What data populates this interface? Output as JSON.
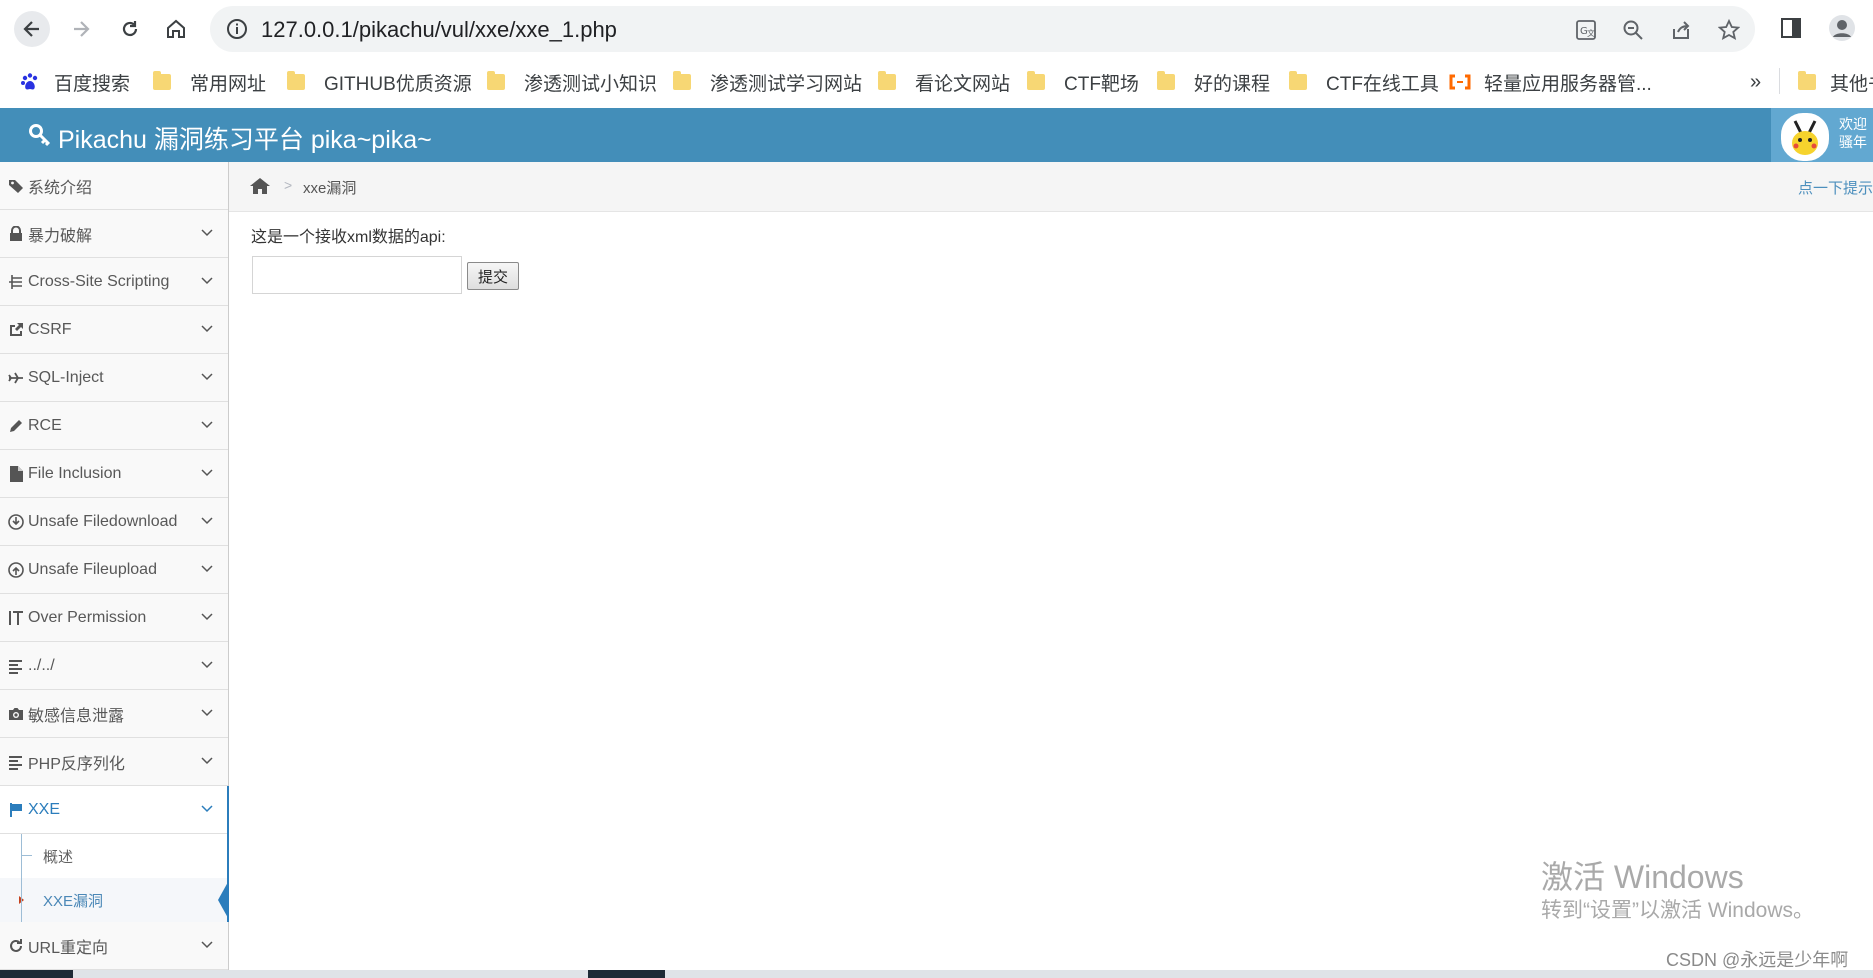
{
  "browser": {
    "url": "127.0.0.1/pikachu/vul/xxe/xxe_1.php",
    "bookmarks": [
      {
        "label": "百度搜索",
        "icon": "baidu-paw-icon"
      },
      {
        "label": "常用网址",
        "icon": "folder-icon"
      },
      {
        "label": "GITHUB优质资源",
        "icon": "folder-icon"
      },
      {
        "label": "渗透测试小知识",
        "icon": "folder-icon"
      },
      {
        "label": "渗透测试学习网站",
        "icon": "folder-icon"
      },
      {
        "label": "看论文网站",
        "icon": "folder-icon"
      },
      {
        "label": "CTF靶场",
        "icon": "folder-icon"
      },
      {
        "label": "好的课程",
        "icon": "folder-icon"
      },
      {
        "label": "CTF在线工具",
        "icon": "folder-icon"
      },
      {
        "label": "轻量应用服务器管...",
        "icon": "aliyun-icon"
      }
    ],
    "overflow_label": "»",
    "other_bookmarks": "其他书"
  },
  "app": {
    "title": "Pikachu 漏洞练习平台 pika~pika~",
    "welcome_line1": "欢迎",
    "welcome_line2": "骚年"
  },
  "sidebar": {
    "items": [
      {
        "label": "系统介绍",
        "icon": "tags-icon",
        "has_chevron": false
      },
      {
        "label": "暴力破解",
        "icon": "lock-icon",
        "has_chevron": true
      },
      {
        "label": "Cross-Site Scripting",
        "icon": "sitemap-icon",
        "has_chevron": true
      },
      {
        "label": "CSRF",
        "icon": "share-icon",
        "has_chevron": true
      },
      {
        "label": "SQL-Inject",
        "icon": "plane-icon",
        "has_chevron": true
      },
      {
        "label": "RCE",
        "icon": "pencil-icon",
        "has_chevron": true
      },
      {
        "label": "File Inclusion",
        "icon": "file-icon",
        "has_chevron": true
      },
      {
        "label": "Unsafe Filedownload",
        "icon": "download-icon",
        "has_chevron": true
      },
      {
        "label": "Unsafe Fileupload",
        "icon": "upload-icon",
        "has_chevron": true
      },
      {
        "label": "Over Permission",
        "icon": "text-height-icon",
        "has_chevron": true
      },
      {
        "label": "../../",
        "icon": "align-left-icon",
        "has_chevron": true
      },
      {
        "label": "敏感信息泄露",
        "icon": "camera-icon",
        "has_chevron": true
      },
      {
        "label": "PHP反序列化",
        "icon": "align-left-icon",
        "has_chevron": true
      },
      {
        "label": "XXE",
        "icon": "flag-icon",
        "has_chevron": true,
        "active": true
      },
      {
        "label": "URL重定向",
        "icon": "refresh-icon",
        "has_chevron": true
      }
    ],
    "xxe_sub": [
      {
        "label": "概述"
      },
      {
        "label": "XXE漏洞",
        "active": true
      }
    ]
  },
  "breadcrumb": {
    "current": "xxe漏洞",
    "separator": ">",
    "tip": "点一下提示"
  },
  "content": {
    "label": "这是一个接收xml数据的api:",
    "input_value": "",
    "submit_label": "提交"
  },
  "watermark": {
    "line1": "激活 Windows",
    "line2": "转到“设置”以激活 Windows。",
    "csdn": "CSDN @永远是少年啊"
  },
  "colors": {
    "header_bg": "#438eb9",
    "user_bg": "#62a8d1",
    "active_link": "#2b7dbc"
  }
}
